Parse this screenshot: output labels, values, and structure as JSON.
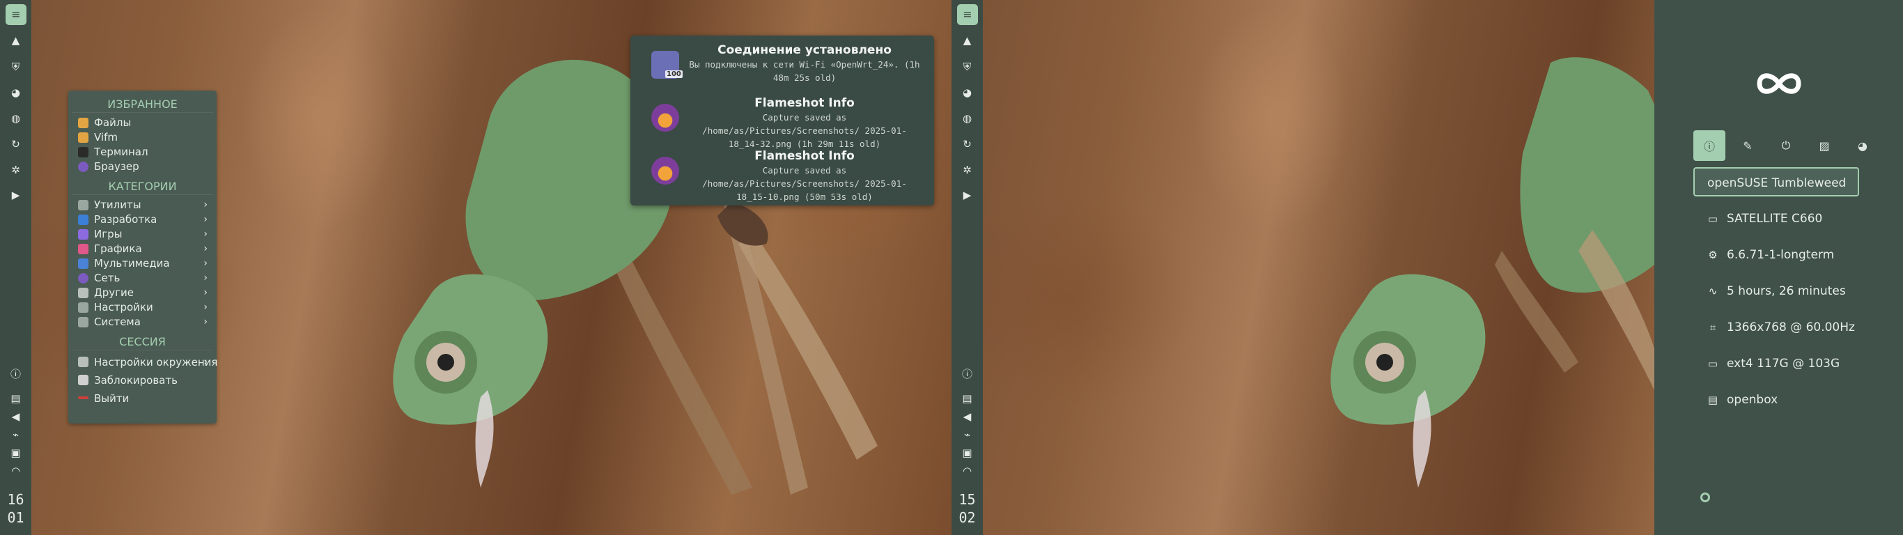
{
  "panel": {
    "clock_left": {
      "hour": "16",
      "minute": "01"
    },
    "clock_right": {
      "hour": "15",
      "minute": "02"
    },
    "icons": [
      "filter-icon",
      "mountain-icon",
      "shield-icon",
      "palette-icon",
      "globe-icon",
      "refresh-icon",
      "aperture-icon",
      "play-icon",
      "info-icon",
      "clipboard-icon",
      "volume-icon",
      "usb-icon",
      "screen-icon",
      "wifi-icon"
    ]
  },
  "menu": {
    "favorites_title": "ИЗБРАННОЕ",
    "favorites": [
      "Файлы",
      "Vifm",
      "Терминал",
      "Браузер"
    ],
    "categories_title": "КАТЕГОРИИ",
    "categories": [
      "Утилиты",
      "Разработка",
      "Игры",
      "Графика",
      "Мультимедиа",
      "Сеть",
      "Другие",
      "Настройки",
      "Система"
    ],
    "session_title": "СЕССИЯ",
    "session": [
      "Настройки окружения",
      "Заблокировать",
      "Выйти"
    ],
    "colors": {
      "accent": "#a4ceb0",
      "bg": "#4a5b53"
    }
  },
  "notifications": [
    {
      "title": "Соединение установлено",
      "body": "Вы подключены к сети Wi-Fi «OpenWrt_24». (1h 48m 25s old)",
      "badge": "100",
      "icon": "wifi-signal-icon"
    },
    {
      "title": "Flameshot Info",
      "body": "Capture saved as /home/as/Pictures/Screenshots/ 2025-01-18_14-32.png (1h 29m 11s old)",
      "icon": "flameshot-icon"
    },
    {
      "title": "Flameshot Info",
      "body": "Capture saved as /home/as/Pictures/Screenshots/ 2025-01-18_15-10.png (50m 53s old)",
      "icon": "flameshot-icon"
    }
  ],
  "sidebar": {
    "logo": "infinity-logo",
    "tabs": [
      "info-icon",
      "brush-icon",
      "power-icon",
      "image-icon",
      "palette-icon"
    ],
    "info": [
      {
        "icon": "",
        "text": "openSUSE Tumbleweed"
      },
      {
        "icon": "laptop-icon",
        "text": "SATELLITE C660"
      },
      {
        "icon": "gear-icon",
        "text": "6.6.71-1-longterm"
      },
      {
        "icon": "activity-icon",
        "text": "5 hours, 26 minutes"
      },
      {
        "icon": "crop-icon",
        "text": "1366x768 @ 60.00Hz"
      },
      {
        "icon": "drive-icon",
        "text": "ext4 117G @ 103G"
      },
      {
        "icon": "window-icon",
        "text": "openbox"
      }
    ]
  }
}
